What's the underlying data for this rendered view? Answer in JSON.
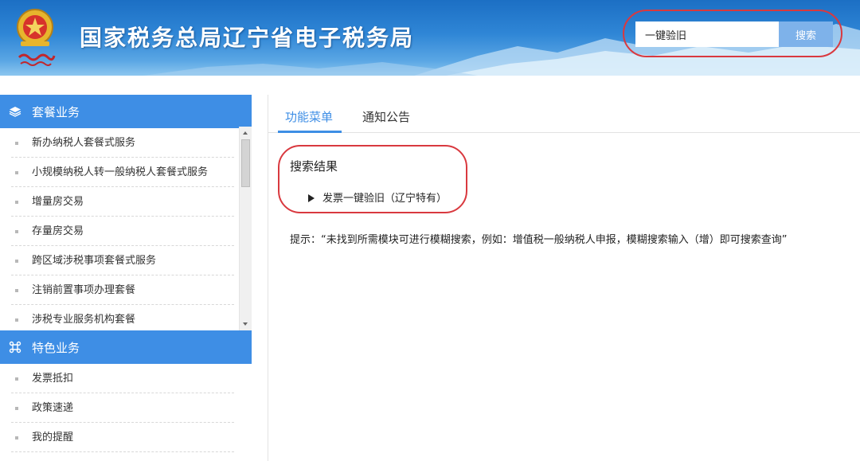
{
  "header": {
    "title": "国家税务总局辽宁省电子税务局",
    "logo_icon": "tax-emblem-icon",
    "search": {
      "value": "一键验旧",
      "button_label": "搜索"
    }
  },
  "sidebar": {
    "sections": [
      {
        "label": "套餐业务",
        "icon": "layers-icon",
        "items": [
          "新办纳税人套餐式服务",
          "小规模纳税人转一般纳税人套餐式服务",
          "增量房交易",
          "存量房交易",
          "跨区域涉税事项套餐式服务",
          "注销前置事项办理套餐",
          "涉税专业服务机构套餐"
        ]
      },
      {
        "label": "特色业务",
        "icon": "command-icon",
        "items": [
          "发票抵扣",
          "政策速递",
          "我的提醒"
        ]
      }
    ]
  },
  "main": {
    "tabs": [
      {
        "label": "功能菜单",
        "active": true
      },
      {
        "label": "通知公告",
        "active": false
      }
    ],
    "results_title": "搜索结果",
    "results": [
      "发票一键验旧（辽宁特有）"
    ],
    "tip": "提示：“未找到所需模块可进行模糊搜索，例如：增值税一般纳税人申报，模糊搜索输入（增）即可搜索查询”"
  },
  "colors": {
    "accent": "#3e8ee5",
    "highlight_ring": "#d9393f",
    "header_blue": "#2f86d6"
  }
}
